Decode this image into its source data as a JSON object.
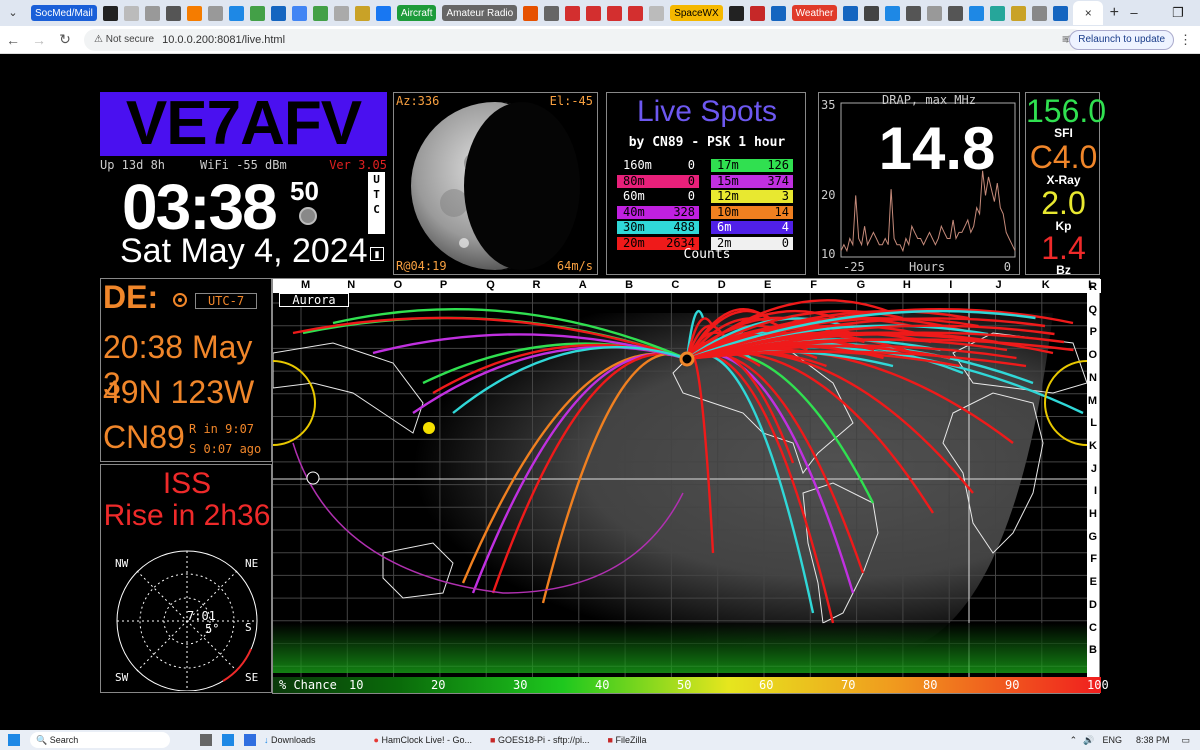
{
  "browser": {
    "bookmarks": [
      {
        "label": "SocMed/Mail",
        "color": "#1a5fd8"
      },
      {
        "label": "Aircraft",
        "color": "#1d9b3a"
      },
      {
        "label": "Amateur Radio",
        "color": "#666666"
      },
      {
        "label": "SpaceWX",
        "color": "#f5b800"
      },
      {
        "label": "Weather",
        "color": "#e03a2a"
      }
    ],
    "tab_close": "×",
    "new_tab": "+",
    "security": "Not secure",
    "url": "10.0.0.200:8081/live.html",
    "relaunch": "Relaunch to update"
  },
  "header": {
    "callsign": "VE7AFV",
    "uptime": "Up 13d 8h",
    "wifi": "WiFi  -55 dBm",
    "version": "Ver 3.05",
    "time": "03:38",
    "seconds": "50",
    "utc": [
      "U",
      "T",
      "C"
    ],
    "date": "Sat  May  4, 2024"
  },
  "moon": {
    "az": "Az:336",
    "el": "El:-45",
    "rise": "R@04:19",
    "speed": "64m/s"
  },
  "spots": {
    "title": "Live Spots",
    "subtitle": "by CN89 - PSK 1 hour",
    "footer": "Counts",
    "bands_left": [
      {
        "band": "160m",
        "count": "0",
        "color": "#000000",
        "text": "#ffffff"
      },
      {
        "band": "80m",
        "count": "0",
        "color": "#e8207a",
        "text": "#000000"
      },
      {
        "band": "60m",
        "count": "0",
        "color": "#000000",
        "text": "#ffffff"
      },
      {
        "band": "40m",
        "count": "328",
        "color": "#c020e0",
        "text": "#000000"
      },
      {
        "band": "30m",
        "count": "488",
        "color": "#30d8d8",
        "text": "#000000"
      },
      {
        "band": "20m",
        "count": "2634",
        "color": "#ef1a1a",
        "text": "#000000"
      }
    ],
    "bands_right": [
      {
        "band": "17m",
        "count": "126",
        "color": "#30e050",
        "text": "#000000"
      },
      {
        "band": "15m",
        "count": "374",
        "color": "#c030e0",
        "text": "#000000"
      },
      {
        "band": "12m",
        "count": "3",
        "color": "#e8e830",
        "text": "#000000"
      },
      {
        "band": "10m",
        "count": "14",
        "color": "#f08020",
        "text": "#000000"
      },
      {
        "band": "6m",
        "count": "4",
        "color": "#5020e8",
        "text": "#ffffff"
      },
      {
        "band": "2m",
        "count": "0",
        "color": "#f0f0f0",
        "text": "#000000"
      }
    ]
  },
  "drap": {
    "title": "DRAP, max MHz",
    "value": "14.8",
    "y_top": "35",
    "y_mid": "20",
    "y_bot": "10",
    "x_left": "-25",
    "x_label": "Hours",
    "x_right": "0",
    "series": [
      11,
      12,
      11,
      13,
      12,
      20,
      13,
      12,
      15,
      12,
      13,
      14,
      13,
      12,
      12,
      13,
      12,
      21,
      13,
      12,
      12,
      11,
      13,
      12,
      15,
      14,
      13,
      13,
      12,
      13,
      14,
      13,
      12,
      13,
      15,
      14,
      13,
      13,
      16,
      13,
      14,
      14,
      15,
      16,
      14,
      15,
      18,
      17,
      24,
      20,
      23,
      21,
      19,
      22,
      18,
      17,
      14,
      13,
      12,
      11
    ]
  },
  "space_wx": {
    "sfi": "156.0",
    "sfi_label": "SFI",
    "sfi_color": "#30e050",
    "xray": "C4.0",
    "xray_label": "X-Ray",
    "xray_color": "#f0862a",
    "kp": "2.0",
    "kp_label": "Kp",
    "kp_color": "#e8e830",
    "bz": "1.4",
    "bz_label": "Bz",
    "bz_color": "#ef2a2a"
  },
  "de": {
    "label": "DE:",
    "tz": "UTC-7",
    "time": "20:38 May 3",
    "latlon": "49N  123W",
    "grid": "CN89",
    "rise": "R in 9:07",
    "set": "S 0:07 ago"
  },
  "iss": {
    "line1": "ISS",
    "line2": "Rise in  2h36",
    "dirs": {
      "nw": "NW",
      "ne": "NE",
      "sw": "SW",
      "se": "SE",
      "s": "S"
    },
    "time": "7:01",
    "elev": "5°"
  },
  "map": {
    "aurora_label": "Aurora",
    "top_grid": [
      "M",
      "N",
      "O",
      "P",
      "Q",
      "R",
      "A",
      "B",
      "C",
      "D",
      "E",
      "F",
      "G",
      "H",
      "I",
      "J",
      "K",
      "L"
    ],
    "right_grid": [
      "R",
      "Q",
      "P",
      "O",
      "N",
      "M",
      "L",
      "K",
      "J",
      "I",
      "H",
      "G",
      "F",
      "E",
      "D",
      "C",
      "B"
    ],
    "pct_label": "% Chance",
    "pct_ticks": [
      "10",
      "20",
      "30",
      "40",
      "50",
      "60",
      "70",
      "80",
      "90",
      "100"
    ]
  },
  "taskbar": {
    "search": "Search",
    "apps": [
      "Downloads",
      "HamClock Live! - Go...",
      "GOES18-Pi - sftp://pi...",
      "FileZilla"
    ],
    "lang": "ENG",
    "clock": "8:38 PM"
  }
}
